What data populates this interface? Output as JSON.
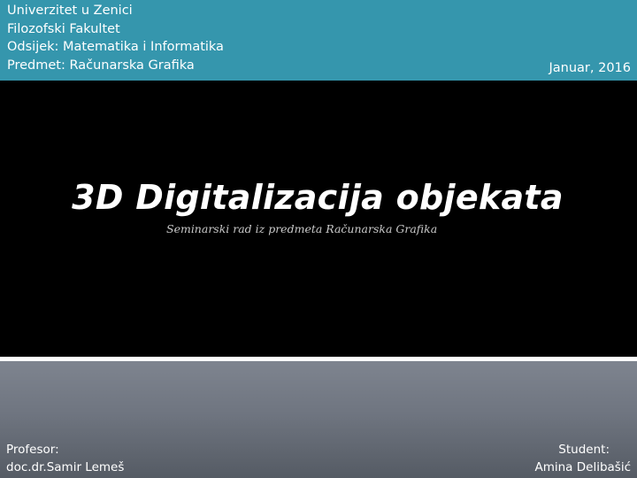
{
  "header": {
    "lines": [
      "Univerzitet u Zenici",
      "Filozofski Fakultet",
      "Odsijek: Matematika i Informatika",
      "Predmet: Računarska Grafika"
    ],
    "date": "Januar, 2016"
  },
  "title": {
    "main": "3D Digitalizacija objekata",
    "subtitle": "Seminarski rad iz predmeta Računarska Grafika"
  },
  "footer": {
    "professor_label": "Profesor:",
    "professor_name": "doc.dr.Samir Lemeš",
    "student_label": "Student:",
    "student_name": "Amina Delibašić"
  },
  "colors": {
    "header_band": "#3596ad",
    "title_background": "#000000",
    "footer_band": "#6f7580",
    "divider": "#ffffff",
    "text": "#ffffff"
  }
}
